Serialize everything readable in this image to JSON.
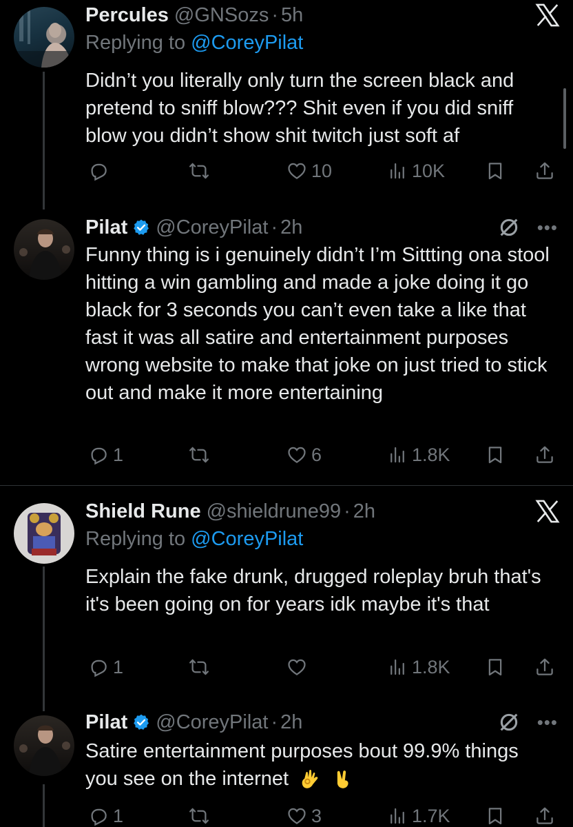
{
  "colors": {
    "background": "#000000",
    "text": "#e7e9ea",
    "muted": "#71767b",
    "link": "#1d9bf0",
    "verified": "#1d9bf0"
  },
  "tweets": [
    {
      "name": "Percules",
      "handle": "@GNSozs",
      "time": "5h",
      "replying_label": "Replying to",
      "replying_to": "@CoreyPilat",
      "text": "Didn’t you literally only turn the screen black and pretend to sniff blow??? Shit even if you did sniff blow you didn’t show shit twitch just soft af",
      "replies": "",
      "retweets": "",
      "likes": "10",
      "views": "10K",
      "corner_icon": "x-logo-icon"
    },
    {
      "name": "Pilat",
      "handle": "@CoreyPilat",
      "time": "2h",
      "verified": true,
      "text": "Funny thing is i genuinely didn’t I’m Sittting ona stool hitting a win gambling and made a joke doing it go black for 3 seconds you can’t even take a like that fast it was all satire and entertainment purposes wrong website to make that joke on just tried to stick out and make it more entertaining",
      "replies": "1",
      "retweets": "",
      "likes": "6",
      "views": "1.8K",
      "corner_icon": "grok-icon"
    },
    {
      "name": "Shield Rune",
      "handle": "@shieldrune99",
      "time": "2h",
      "replying_label": "Replying to",
      "replying_to": "@CoreyPilat",
      "text": "Explain the fake drunk, drugged roleplay bruh that's it's been going on for years idk maybe it's that",
      "replies": "1",
      "retweets": "",
      "likes": "",
      "views": "1.8K",
      "corner_icon": "x-logo-icon"
    },
    {
      "name": "Pilat",
      "handle": "@CoreyPilat",
      "time": "2h",
      "verified": true,
      "text": "Satire entertainment purposes bout 99.9% things you see on the internet",
      "emojis": [
        "ok-hand-emoji",
        "victory-hand-emoji"
      ],
      "replies": "1",
      "retweets": "",
      "likes": "3",
      "views": "1.7K",
      "corner_icon": "grok-icon"
    }
  ],
  "separator": "·"
}
